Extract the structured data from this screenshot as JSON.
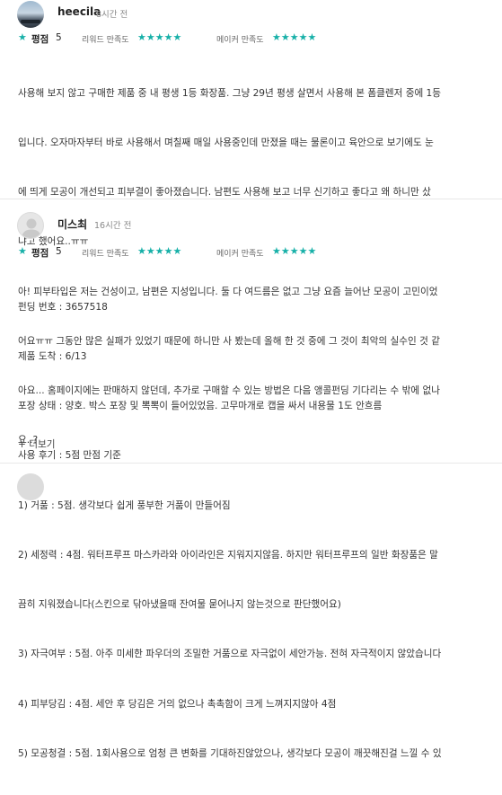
{
  "reviews": [
    {
      "author": "heecila",
      "time": "8시간 전",
      "rating_title": "평점",
      "rating_score": "5",
      "sub_label_1": "리워드 만족도",
      "sub_label_2": "메이커 만족도",
      "stars_1": "★★★★★",
      "stars_2": "★★★★★",
      "lines": [
        "사용해 보지 않고 구매한 제품 중 내 평생 1등 화장품. 그냥 29년 평생 살면서 사용해 본 폼클렌저 중에 1등",
        "입니다. 오자마자부터 바로 사용해서 며칠째 매일 사용중인데 만졌을 때는 물론이고 육안으로 보기에도 눈",
        "에 띄게 모공이 개선되고 피부결이 좋아졌습니다. 남편도 사용해 보고 너무 신기하고 좋다고 왜 하니만 샀",
        "냐고 했어요..ㅠㅠ",
        "아! 피부타입은 저는 건성이고, 남편은 지성입니다. 둘 다 여드름은 없고 그냥 요즘 늘어난 모공이 고민이었",
        "어요ㅠㅠ 그동안 많은 실패가 있었기 때문에 하니만 사 봤는데 올해 한 것 중에 그 것이 최악의 실수인 것 같",
        "아요... 홈페이지에는 판매하지 않던데, 추가로 구매할 수 있는 방법은 다음 앵콜펀딩 기다리는 수 밖에 없나",
        "요..?"
      ]
    },
    {
      "author": "미스최",
      "time": "16시간 전",
      "rating_title": "평점",
      "rating_score": "5",
      "sub_label_1": "리워드 만족도",
      "sub_label_2": "메이커 만족도",
      "stars_1": "★★★★★",
      "stars_2": "★★★★★",
      "lines": [
        "펀딩 번호 : 3657518",
        "제품 도착 : 6/13",
        "포장 상태 : 양호. 박스 포장 및 뽁뽁이 들어있었음. 고무마개로 캡을 싸서 내용물 1도 안흐름",
        "사용 후기 : 5점 만점 기준",
        "1) 거품 : 5점. 생각보다 쉽게 풍부한 거품이 만들어짐",
        "2) 세정력 : 4점. 워터프루프 마스카라와 아이라인은 지워지지않음. 하지만 워터프루프의 일반 화장품은 말",
        "끔히 지워졌습니다(스킨으로 닦아냈을때 잔여물 묻어나지 않는것으로 판단했어요)",
        "3) 자극여부 : 5점. 아주 미세한 파우더의 조밀한 거품으로 자극없이 세안가능. 전혀 자극적이지 않았습니다",
        "4) 피부당김 : 4점. 세안 후 당김은 거의 없으나 촉촉함이 크게 느껴지지않아 4점",
        "5) 모공청결 : 5점. 1회사용으로 엄청 큰 변화를 기대하진않았으나, 생각보다 모공이 깨끗해진걸 느낄 수 있"
      ],
      "more_label": "+ 더보기"
    }
  ],
  "colors": {
    "accent": "#17b0a8"
  }
}
